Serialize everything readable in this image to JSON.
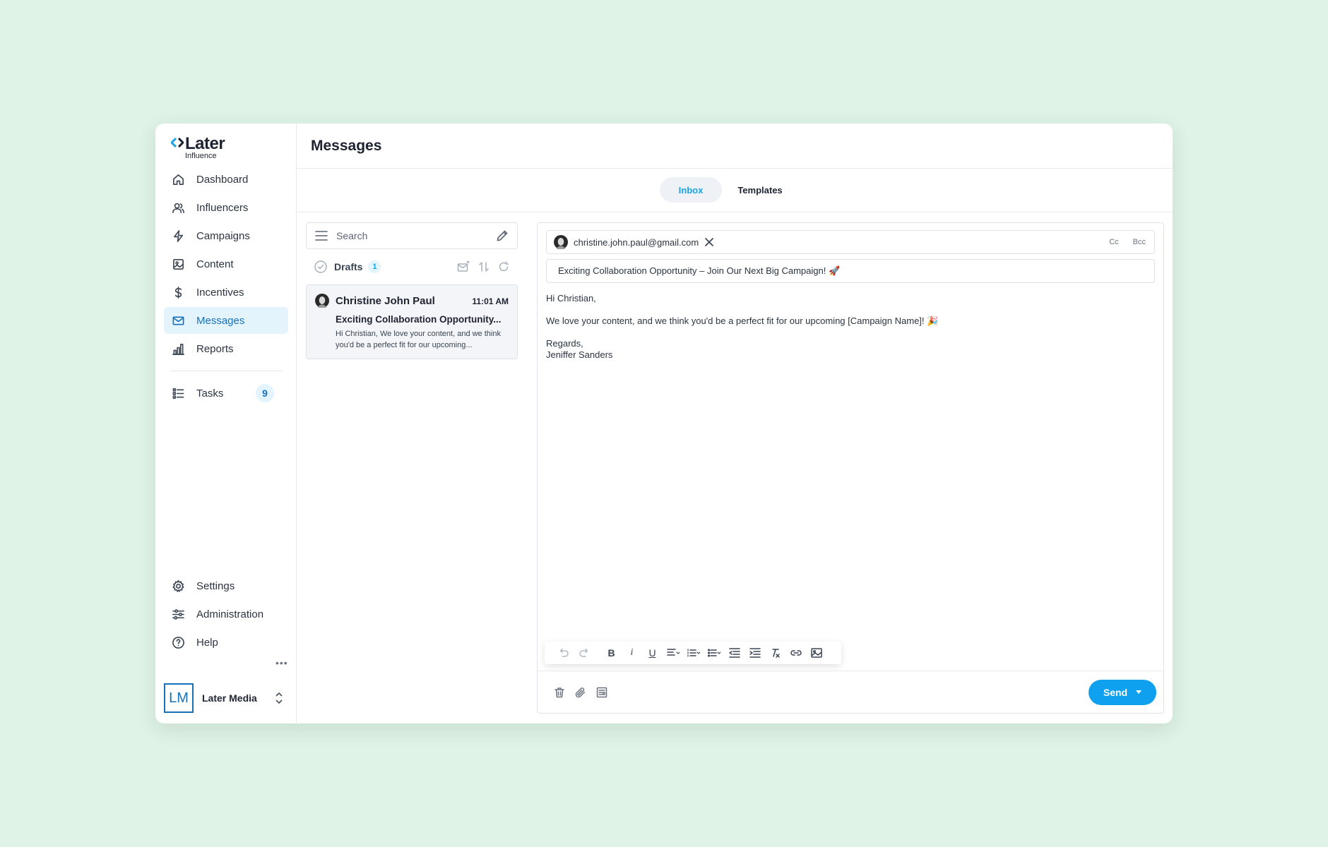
{
  "brand": {
    "name": "Later",
    "sub": "Influence",
    "accent": "#1aa3e8"
  },
  "sidebar": {
    "items": [
      {
        "label": "Dashboard",
        "icon": "home-icon"
      },
      {
        "label": "Influencers",
        "icon": "users-icon"
      },
      {
        "label": "Campaigns",
        "icon": "lightning-icon"
      },
      {
        "label": "Content",
        "icon": "image-icon"
      },
      {
        "label": "Incentives",
        "icon": "dollar-icon"
      },
      {
        "label": "Messages",
        "icon": "mail-icon",
        "active": true
      },
      {
        "label": "Reports",
        "icon": "bar-chart-icon"
      }
    ],
    "tasks": {
      "label": "Tasks",
      "count": "9",
      "icon": "list-icon"
    },
    "bottom": [
      {
        "label": "Settings",
        "icon": "gear-icon"
      },
      {
        "label": "Administration",
        "icon": "sliders-icon"
      },
      {
        "label": "Help",
        "icon": "help-icon"
      }
    ],
    "org": {
      "initials": "LM",
      "name": "Later Media"
    }
  },
  "header": {
    "title": "Messages"
  },
  "tabs": {
    "inbox": "Inbox",
    "templates": "Templates"
  },
  "list": {
    "search_placeholder": "Search",
    "folder": {
      "label": "Drafts",
      "count": "1"
    },
    "messages": [
      {
        "sender": "Christine John Paul",
        "time": "11:01 AM",
        "subject": "Exciting Collaboration Opportunity...",
        "preview": "Hi Christian, We love your content, and we think you'd be a perfect fit for our upcoming..."
      }
    ]
  },
  "compose": {
    "to": "christine.john.paul@gmail.com",
    "cc_label": "Cc",
    "bcc_label": "Bcc",
    "subject": "Exciting Collaboration Opportunity – Join Our Next Big Campaign! 🚀",
    "greeting": "Hi Christian,",
    "body": "We love your content, and we think you'd be a perfect fit for our upcoming [Campaign Name]! 🎉",
    "signoff": "Regards,",
    "signature": "Jeniffer Sanders",
    "send_label": "Send"
  }
}
